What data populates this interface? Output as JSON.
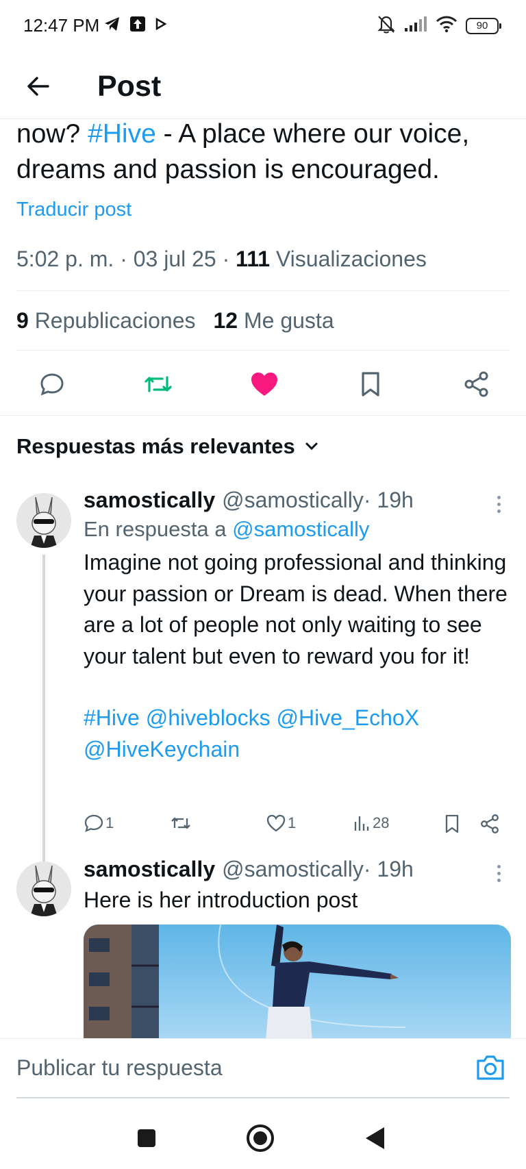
{
  "status_bar": {
    "time": "12:47 PM",
    "battery": "90",
    "left_icons": [
      "telegram-icon",
      "upload-icon",
      "play-icon"
    ],
    "right_icons": [
      "mute-icon",
      "signal-icon",
      "wifi-icon",
      "battery-icon"
    ]
  },
  "header": {
    "title": "Post",
    "back_icon": "arrow-left-icon"
  },
  "post": {
    "text_start": "now? ",
    "hashtag": "#Hive",
    "text_end": " - A place where our voice, dreams and passion is encouraged.",
    "translate": "Traducir post",
    "time": "5:02 p. m.",
    "sep1": " · ",
    "date": "03 jul 25",
    "sep2": " · ",
    "views_count": "111",
    "views_label": " Visualizaciones",
    "reposts_count": "9",
    "reposts_label": " Republicaciones",
    "likes_count": "12",
    "likes_label": " Me gusta",
    "colors": {
      "link": "#1d9bf0",
      "like": "#f91880",
      "repost": "#00ba7c"
    }
  },
  "replies_sort": {
    "label": "Respuestas más relevantes",
    "icon": "chevron-down-icon"
  },
  "replies": [
    {
      "name": "samostically",
      "handle": "@samostically",
      "time": " · 19h",
      "reply_to_label": "En respuesta a ",
      "reply_to_handle": "@samostically",
      "body": "Imagine not going professional and thinking your passion or Dream is dead. When there are a lot of people not only waiting to see your talent but even to reward you for it!",
      "tags_line1": "#Hive @hiveblocks @Hive_EchoX",
      "tags_line2": "@HiveKeychain",
      "comments": "1",
      "likes": "1",
      "views": "28"
    },
    {
      "name": "samostically",
      "handle": "@samostically",
      "time": " · 19h",
      "body": "Here is her introduction post"
    }
  ],
  "composer": {
    "placeholder": "Publicar tu respuesta",
    "camera_icon": "camera-icon"
  },
  "nav_bar": {
    "icons": [
      "recent-apps-icon",
      "home-icon",
      "back-icon"
    ]
  }
}
